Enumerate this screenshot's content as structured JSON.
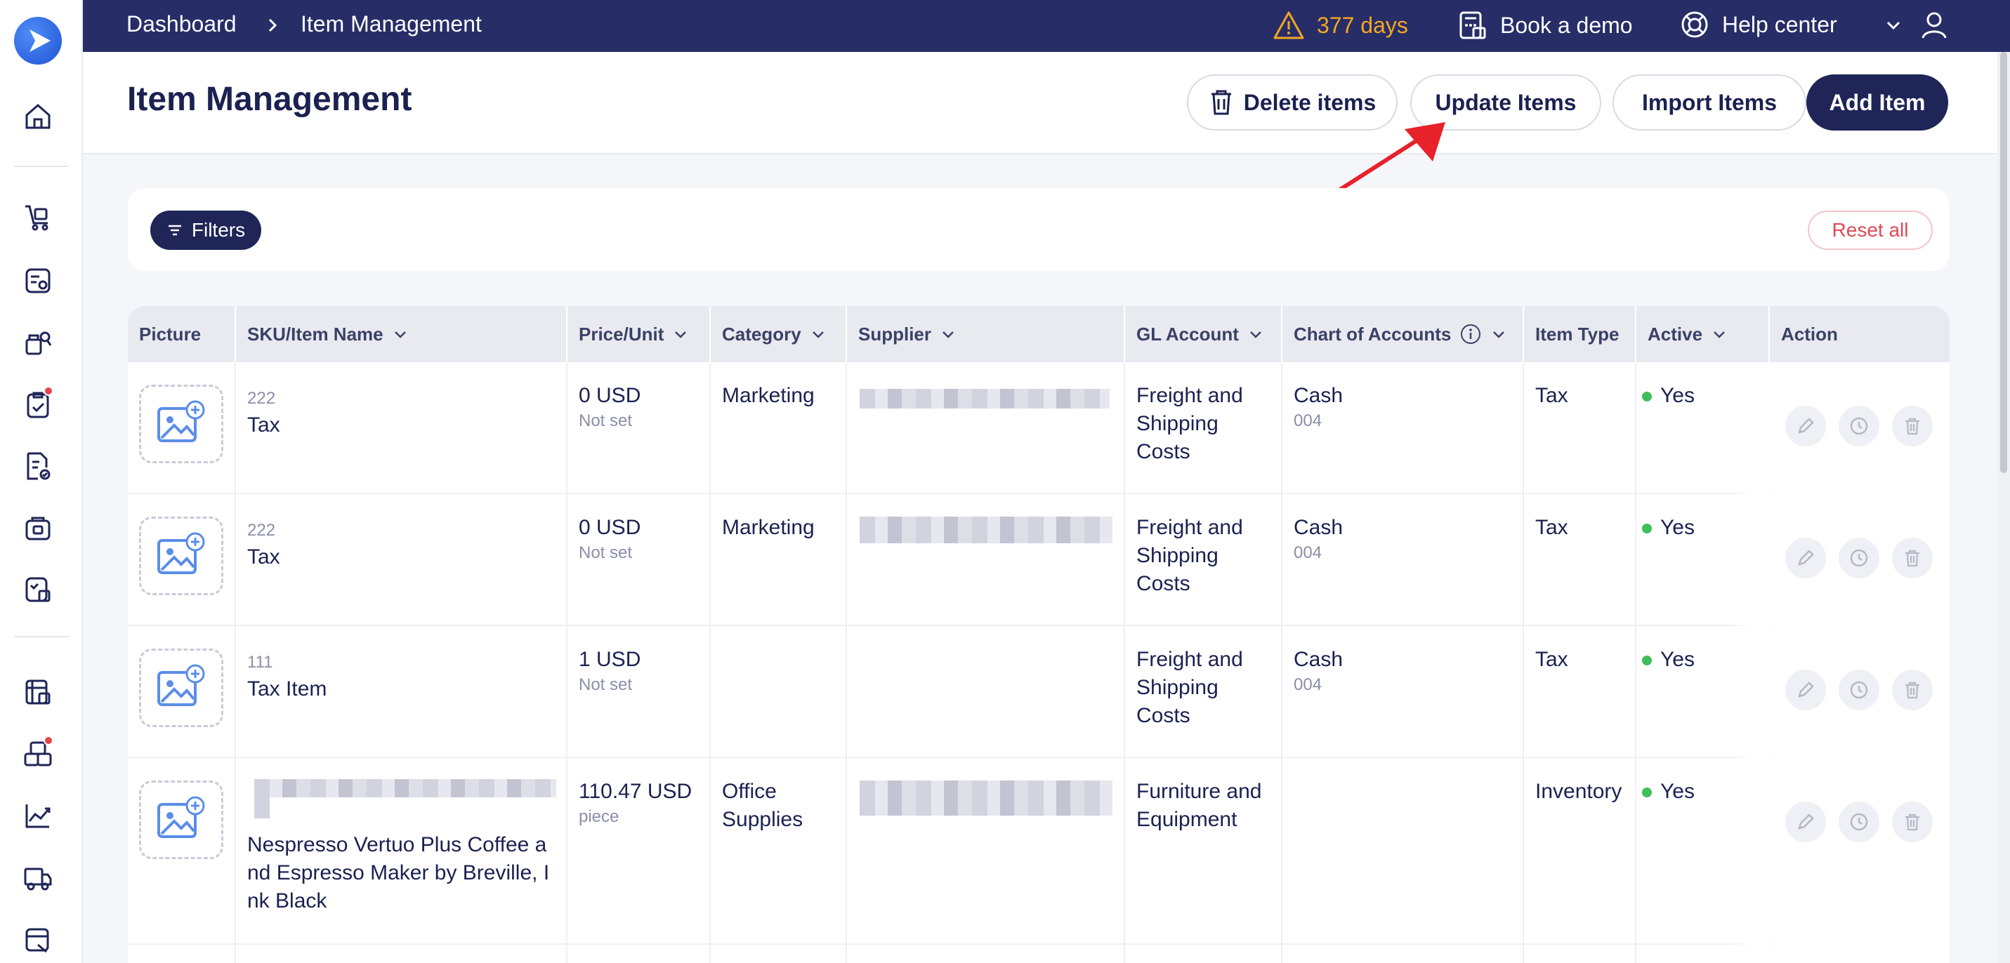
{
  "topbar": {
    "breadcrumb": [
      "Dashboard",
      "Item Management"
    ],
    "trial_warning": "377 days",
    "book_demo": "Book a demo",
    "help_center": "Help center"
  },
  "header": {
    "title": "Item Management",
    "buttons": {
      "delete": "Delete items",
      "update": "Update Items",
      "import": "Import Items",
      "add": "Add Item"
    }
  },
  "filters": {
    "filters_label": "Filters",
    "reset_label": "Reset all"
  },
  "table": {
    "columns": [
      "Picture",
      "SKU/Item Name",
      "Price/Unit",
      "Category",
      "Supplier",
      "GL Account",
      "Chart of Accounts",
      "Item Type",
      "Active",
      "Action"
    ],
    "rows": [
      {
        "sku": "222",
        "name": "Tax",
        "price": "0 USD",
        "unit": "Not set",
        "category": "Marketing",
        "gl_line1": "Freight and",
        "gl_line2": "Shipping",
        "gl_line3": "Costs",
        "coa": "Cash",
        "coa_code": "004",
        "item_type": "Tax",
        "active": "Yes"
      },
      {
        "sku": "222",
        "name": "Tax",
        "price": "0 USD",
        "unit": "Not set",
        "category": "Marketing",
        "gl_line1": "Freight and",
        "gl_line2": "Shipping",
        "gl_line3": "Costs",
        "coa": "Cash",
        "coa_code": "004",
        "item_type": "Tax",
        "active": "Yes"
      },
      {
        "sku": "111",
        "name": "Tax Item",
        "price": "1 USD",
        "unit": "Not set",
        "category": "",
        "gl_line1": "Freight and",
        "gl_line2": "Shipping",
        "gl_line3": "Costs",
        "coa": "Cash",
        "coa_code": "004",
        "item_type": "Tax",
        "active": "Yes"
      },
      {
        "sku": "",
        "name_line1": "Nespresso Vertuo Plus Coffee a",
        "name_line2": "nd Espresso Maker by Breville, I",
        "name_line3": "nk Black",
        "price": "110.47 USD",
        "unit": "piece",
        "category_line1": "Office",
        "category_line2": "Supplies",
        "gl_line1": "Furniture and",
        "gl_line2": "Equipment",
        "coa": "",
        "item_type": "Inventory",
        "active": "Yes"
      }
    ]
  },
  "colors": {
    "topbar_bg": "#262d67",
    "primary": "#1f2557",
    "warning": "#f5a623",
    "active_dot": "#3fbf5a",
    "reset": "#e04a55",
    "annotation_arrow": "#e8222a"
  }
}
